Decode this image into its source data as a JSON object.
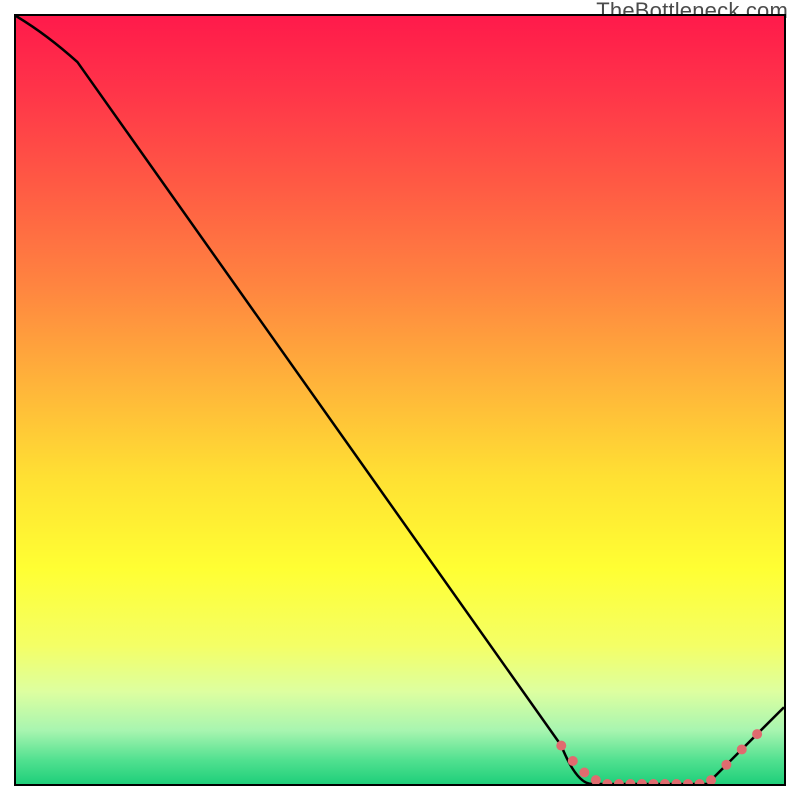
{
  "attribution": "TheBottleneck.com",
  "chart_data": {
    "type": "line",
    "title": "",
    "xlabel": "",
    "ylabel": "",
    "xlim": [
      0,
      100
    ],
    "ylim": [
      0,
      100
    ],
    "x": [
      0,
      8,
      71,
      75,
      90,
      100
    ],
    "values": [
      100,
      94,
      5,
      0,
      0,
      10
    ],
    "markers": {
      "color": "#e06b6f",
      "points": [
        {
          "x": 71,
          "y": 5
        },
        {
          "x": 72.5,
          "y": 3
        },
        {
          "x": 74,
          "y": 1.5
        },
        {
          "x": 75.5,
          "y": 0.5
        },
        {
          "x": 77,
          "y": 0
        },
        {
          "x": 78.5,
          "y": 0
        },
        {
          "x": 80,
          "y": 0
        },
        {
          "x": 81.5,
          "y": 0
        },
        {
          "x": 83,
          "y": 0
        },
        {
          "x": 84.5,
          "y": 0
        },
        {
          "x": 86,
          "y": 0
        },
        {
          "x": 87.5,
          "y": 0
        },
        {
          "x": 89,
          "y": 0
        },
        {
          "x": 90.5,
          "y": 0.5
        },
        {
          "x": 92.5,
          "y": 2.5
        },
        {
          "x": 94.5,
          "y": 4.5
        },
        {
          "x": 96.5,
          "y": 6.5
        }
      ]
    },
    "gradient_stops": [
      {
        "offset": 0.0,
        "color": "#ff1a4b"
      },
      {
        "offset": 0.1,
        "color": "#ff3549"
      },
      {
        "offset": 0.22,
        "color": "#ff5a44"
      },
      {
        "offset": 0.35,
        "color": "#ff8440"
      },
      {
        "offset": 0.48,
        "color": "#ffb43a"
      },
      {
        "offset": 0.6,
        "color": "#ffe033"
      },
      {
        "offset": 0.72,
        "color": "#ffff33"
      },
      {
        "offset": 0.82,
        "color": "#f4ff66"
      },
      {
        "offset": 0.88,
        "color": "#ddffa0"
      },
      {
        "offset": 0.93,
        "color": "#a8f5b0"
      },
      {
        "offset": 0.97,
        "color": "#4fe08f"
      },
      {
        "offset": 1.0,
        "color": "#1fcf7a"
      }
    ]
  }
}
